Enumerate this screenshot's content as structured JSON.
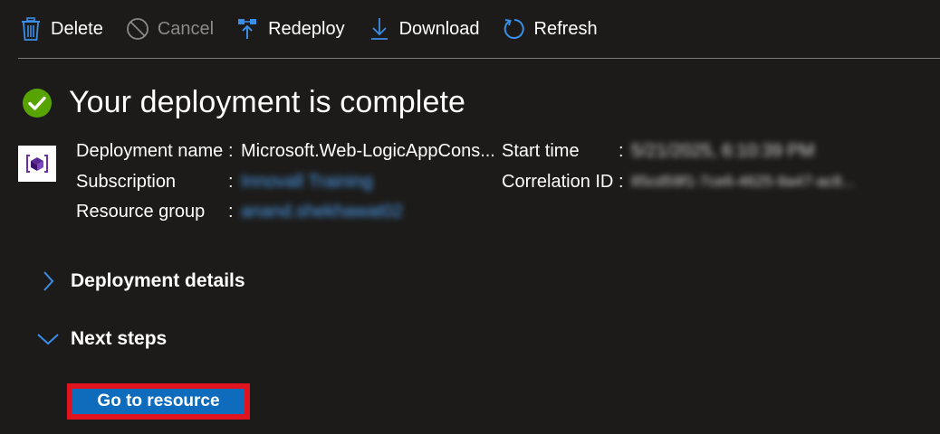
{
  "toolbar": {
    "delete_label": "Delete",
    "cancel_label": "Cancel",
    "redeploy_label": "Redeploy",
    "download_label": "Download",
    "refresh_label": "Refresh"
  },
  "header": {
    "title": "Your deployment is complete"
  },
  "details": {
    "deployment_name_key": "Deployment name",
    "deployment_name_value": "Microsoft.Web-LogicAppCons...",
    "subscription_key": "Subscription",
    "subscription_value": "Innovall Training",
    "resource_group_key": "Resource group",
    "resource_group_value": "anand.shekhawat02",
    "start_time_key": "Start time",
    "start_time_value": "5/21/2025, 6:10:39 PM",
    "correlation_id_key": "Correlation ID",
    "correlation_id_value": "85cd59f1-7ce6-4625-9a47-ac8...",
    "colon": ":"
  },
  "sections": {
    "deployment_details": "Deployment details",
    "next_steps": "Next steps"
  },
  "actions": {
    "go_to_resource": "Go to resource"
  },
  "colors": {
    "background": "#1c1b1a",
    "accent_blue": "#0f6cbd",
    "link_blue": "#4ea1f3",
    "success_green": "#57a300",
    "highlight_red": "#e0141e"
  },
  "icons": {
    "delete": "trash-icon",
    "cancel": "cancel-icon",
    "redeploy": "redeploy-icon",
    "download": "download-icon",
    "refresh": "refresh-icon",
    "status": "check-circle-icon",
    "resource": "resource-group-icon"
  }
}
